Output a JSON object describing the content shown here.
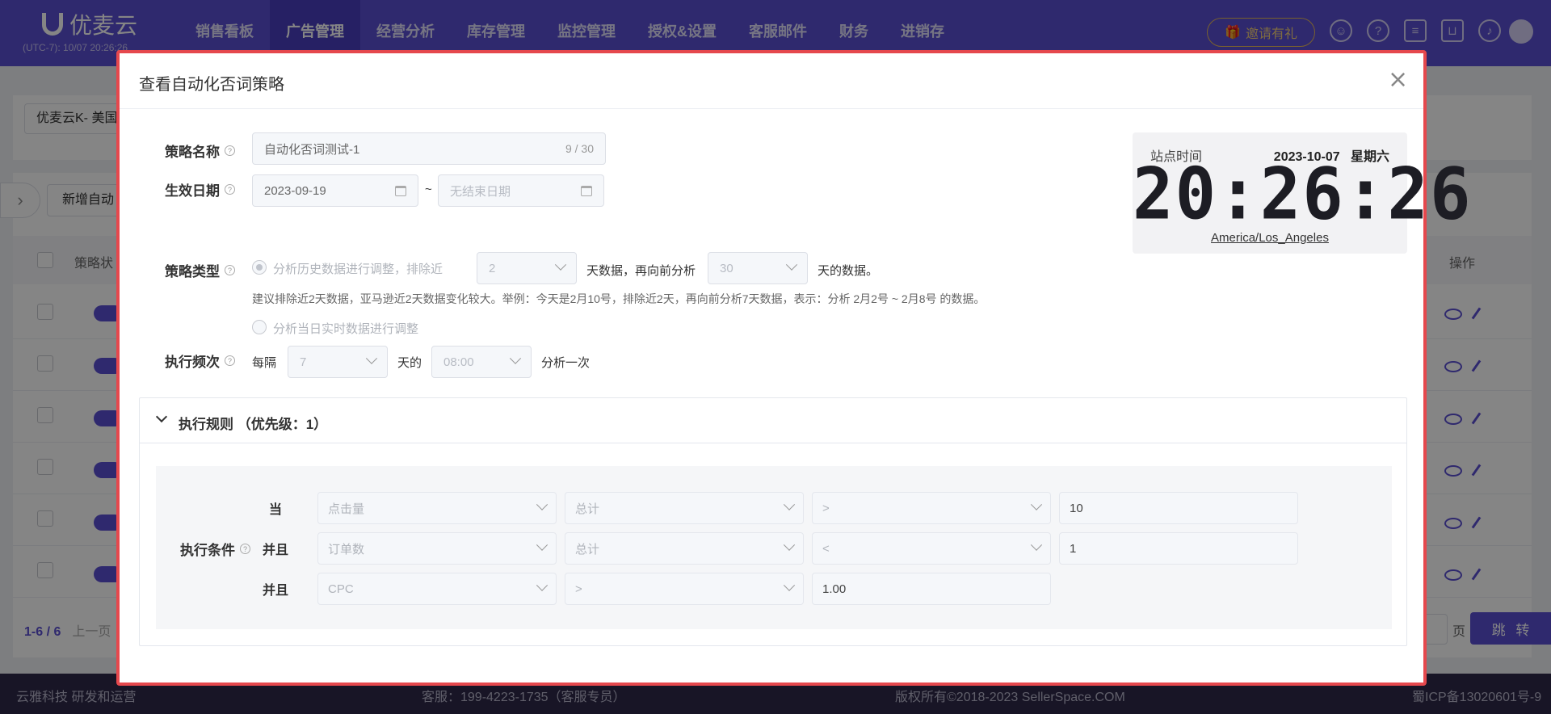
{
  "topbar": {
    "logo_text": "优麦云",
    "timezone_line": "(UTC-7): 10/07 20:26:26",
    "nav": [
      "销售看板",
      "广告管理",
      "经营分析",
      "库存管理",
      "监控管理",
      "授权&设置",
      "客服邮件",
      "财务",
      "进销存"
    ],
    "active_nav_index": 1,
    "invite_label": "邀请有礼"
  },
  "background": {
    "shop_select": "优麦云K- 美国",
    "add_button": "新增自动",
    "column_status": "策略状",
    "column_ops": "操作",
    "pager_range": "1-6 / 6",
    "pager_prev": "上一页",
    "page_unit": "页",
    "jump_button": "跳 转"
  },
  "footer": {
    "left": "云雅科技 研发和运营",
    "service": "客服：199-4223-1735（客服专员）",
    "copyright": "版权所有©2018-2023 SellerSpace.COM",
    "icp": "蜀ICP备13020601号-9"
  },
  "modal": {
    "title": "查看自动化否词策略",
    "name_label": "策略名称",
    "name_value": "自动化否词测试-1",
    "name_count": "9 / 30",
    "date_label": "生效日期",
    "start_date": "2023-09-19",
    "date_sep": "~",
    "end_date_placeholder": "无结束日期",
    "type_label": "策略类型",
    "type_option1_prefix": "分析历史数据进行调整，排除近",
    "type_exclude_days": "2",
    "type_option1_mid": "天数据，再向前分析",
    "type_analyze_days": "30",
    "type_option1_suffix": "天的数据。",
    "type_hint": "建议排除近2天数据，亚马逊近2天数据变化较大。举例：今天是2月10号，排除近2天，再向前分析7天数据，表示：分析 2月2号 ~ 2月8号 的数据。",
    "type_option2": "分析当日实时数据进行调整",
    "freq_label": "执行频次",
    "freq_prefix": "每隔",
    "freq_days": "7",
    "freq_mid": "天的",
    "freq_time": "08:00",
    "freq_suffix": "分析一次"
  },
  "clock": {
    "label": "站点时间",
    "date": "2023-10-07",
    "weekday": "星期六",
    "time": "20:26:26",
    "timezone": "America/Los_Angeles"
  },
  "rules": {
    "title": "执行规则 （优先级：1）",
    "condition_label": "执行条件",
    "rows": [
      {
        "conj": "当",
        "metric": "点击量",
        "agg": "总计",
        "op": ">",
        "value": "10"
      },
      {
        "conj": "并且",
        "metric": "订单数",
        "agg": "总计",
        "op": "<",
        "value": "1"
      },
      {
        "conj": "并且",
        "metric": "CPC",
        "op": ">",
        "value": "1.00"
      }
    ]
  },
  "colors": {
    "brand": "#5b4fd3",
    "highlight_border": "#e5484d"
  }
}
